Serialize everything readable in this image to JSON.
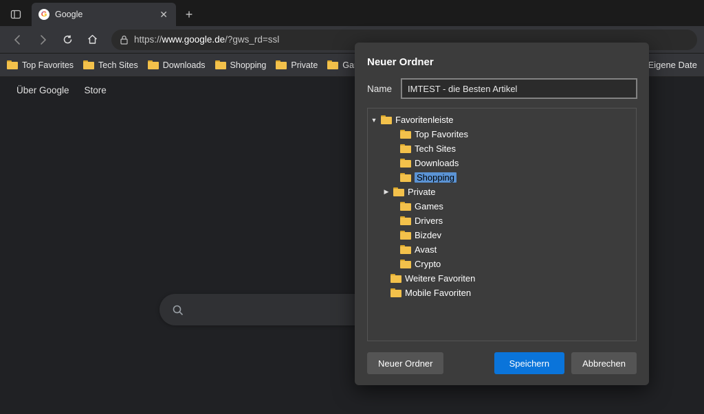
{
  "tab": {
    "title": "Google"
  },
  "address": {
    "scheme": "https://",
    "host": "www.google.de",
    "path": "/?gws_rd=ssl"
  },
  "bookmarks_bar": [
    "Top Favorites",
    "Tech Sites",
    "Downloads",
    "Shopping",
    "Private",
    "Games"
  ],
  "bookmarks_right": "Eigene Date",
  "page_links": {
    "about": "Über Google",
    "store": "Store"
  },
  "dialog": {
    "title": "Neuer Ordner",
    "name_label": "Name",
    "name_value": "IMTEST - die Besten Artikel",
    "tree": {
      "root": "Favoritenleiste",
      "children": [
        "Top Favorites",
        "Tech Sites",
        "Downloads",
        "Shopping",
        "Private",
        "Games",
        "Drivers",
        "Bizdev",
        "Avast",
        "Crypto"
      ],
      "selected": "Shopping",
      "expandable_child": "Private",
      "siblings": [
        "Weitere Favoriten",
        "Mobile Favoriten"
      ]
    },
    "buttons": {
      "new": "Neuer Ordner",
      "save": "Speichern",
      "cancel": "Abbrechen"
    }
  }
}
